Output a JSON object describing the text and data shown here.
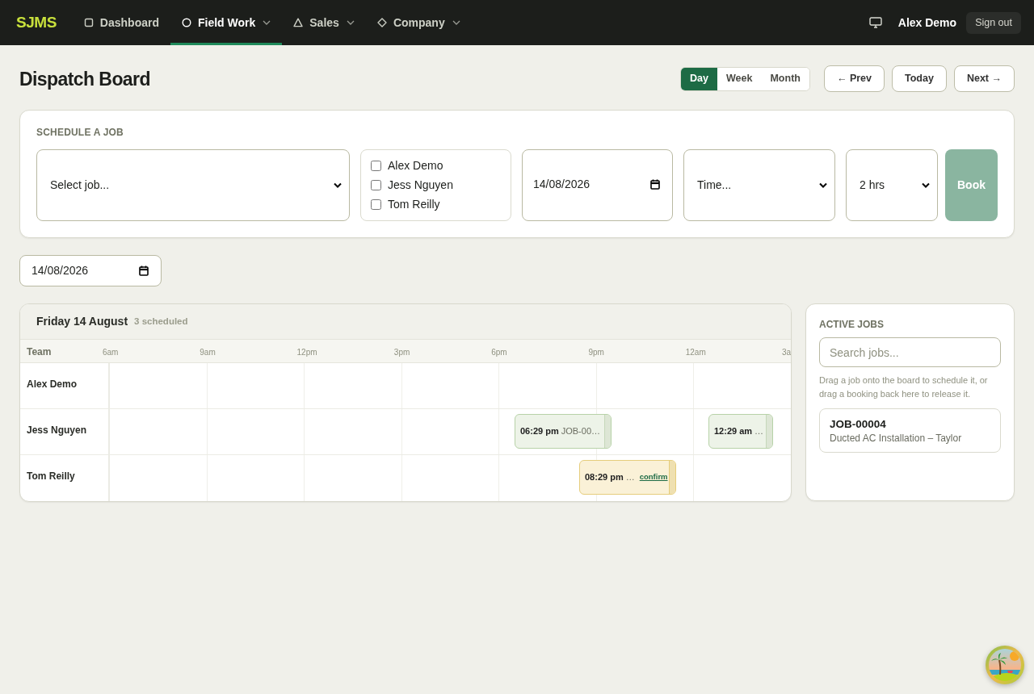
{
  "header": {
    "logo": "SJMS",
    "nav": [
      {
        "label": "Dashboard",
        "selected": false,
        "has_menu": false
      },
      {
        "label": "Field Work",
        "selected": true,
        "has_menu": true
      },
      {
        "label": "Sales",
        "selected": false,
        "has_menu": true
      },
      {
        "label": "Company",
        "selected": false,
        "has_menu": true
      }
    ],
    "user": "Alex Demo",
    "sign_out": "Sign out"
  },
  "page": {
    "title": "Dispatch Board",
    "views": [
      {
        "label": "Day",
        "selected": true
      },
      {
        "label": "Week",
        "selected": false
      },
      {
        "label": "Month",
        "selected": false
      }
    ],
    "nav_buttons": [
      "← Prev",
      "Today",
      "Next →"
    ]
  },
  "schedule_form": {
    "heading": "SCHEDULE A JOB",
    "job_select": "Select job...",
    "team": [
      {
        "name": "Alex Demo",
        "checked": false
      },
      {
        "name": "Jess Nguyen",
        "checked": false
      },
      {
        "name": "Tom Reilly",
        "checked": false
      }
    ],
    "date": "14/08/2026",
    "time_select": "Time...",
    "duration_select": "2 hrs",
    "book_button": {
      "label": "Book",
      "disabled": true
    }
  },
  "date_picker": "14/08/2026",
  "board": {
    "day": "Friday 14 August",
    "count": "3 scheduled",
    "team_header": "Team",
    "hours": [
      "6am",
      "9am",
      "12pm",
      "3pm",
      "6pm",
      "9pm",
      "12am",
      "3a"
    ],
    "rows": [
      {
        "name": "Alex Demo"
      },
      {
        "name": "Jess Nguyen",
        "bookings": [
          {
            "time": "06:29 pm",
            "label": "JOB-00…",
            "confirmed": true
          },
          {
            "time": "12:29 am",
            "label": "…",
            "confirmed": true
          }
        ]
      },
      {
        "name": "Tom Reilly",
        "bookings": [
          {
            "time": "08:29 pm",
            "label": "…",
            "confirmed": false,
            "action": "confirm"
          }
        ]
      }
    ]
  },
  "active_jobs": {
    "heading": "ACTIVE JOBS",
    "search": {
      "placeholder": "Search jobs..."
    },
    "hint": "Drag a job onto the board to schedule it, or drag a booking back here to release it.",
    "jobs": [
      {
        "id": "JOB-00004",
        "title": "Ducted AC Installation – Taylor"
      }
    ]
  }
}
